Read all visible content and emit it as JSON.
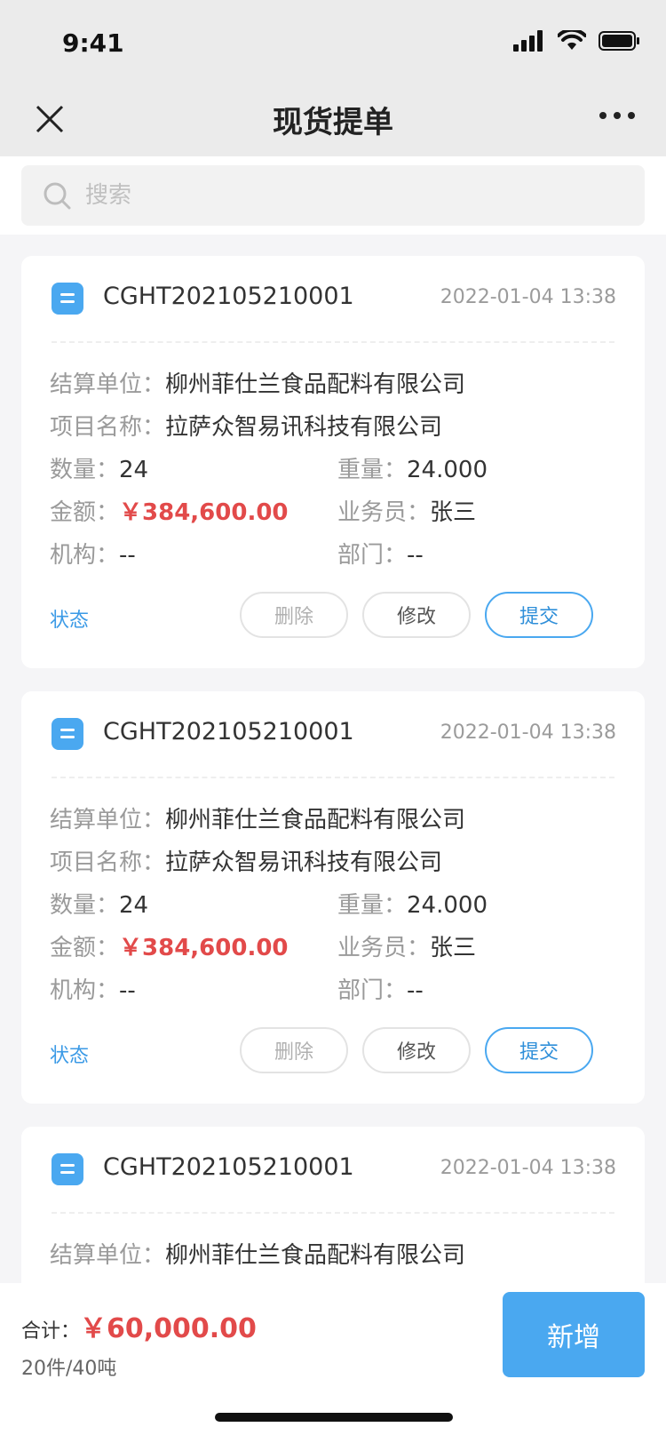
{
  "status_bar": {
    "time": "9:41"
  },
  "nav": {
    "title": "现货提单"
  },
  "search": {
    "placeholder": "搜索"
  },
  "cards": [
    {
      "code": "CGHT202105210001",
      "date": "2022-01-04 13:38",
      "settlement_label": "结算单位：",
      "settlement_value": "柳州菲仕兰食品配料有限公司",
      "project_label": "项目名称：",
      "project_value": "拉萨众智易讯科技有限公司",
      "quantity_label": "数量：",
      "quantity_value": "24",
      "weight_label": "重量：",
      "weight_value": "24.000",
      "amount_label": "金额：",
      "amount_value": "￥384,600.00",
      "salesman_label": "业务员：",
      "salesman_value": "张三",
      "org_label": "机构：",
      "org_value": "--",
      "dept_label": "部门：",
      "dept_value": "--",
      "status_label": "状态",
      "delete_label": "删除",
      "edit_label": "修改",
      "submit_label": "提交"
    },
    {
      "code": "CGHT202105210001",
      "date": "2022-01-04 13:38",
      "settlement_label": "结算单位：",
      "settlement_value": "柳州菲仕兰食品配料有限公司",
      "project_label": "项目名称：",
      "project_value": "拉萨众智易讯科技有限公司",
      "quantity_label": "数量：",
      "quantity_value": "24",
      "weight_label": "重量：",
      "weight_value": "24.000",
      "amount_label": "金额：",
      "amount_value": "￥384,600.00",
      "salesman_label": "业务员：",
      "salesman_value": "张三",
      "org_label": "机构：",
      "org_value": "--",
      "dept_label": "部门：",
      "dept_value": "--",
      "status_label": "状态",
      "delete_label": "删除",
      "edit_label": "修改",
      "submit_label": "提交"
    },
    {
      "code": "CGHT202105210001",
      "date": "2022-01-04 13:38",
      "settlement_label": "结算单位：",
      "settlement_value": "柳州菲仕兰食品配料有限公司"
    }
  ],
  "footer": {
    "total_label": "合计：",
    "total_amount": "￥60,000.00",
    "total_count": "20件/40吨",
    "add_label": "新增"
  },
  "colors": {
    "accent": "#4aa8f0",
    "amount": "#e24a4a",
    "link": "#3b9ae6"
  }
}
